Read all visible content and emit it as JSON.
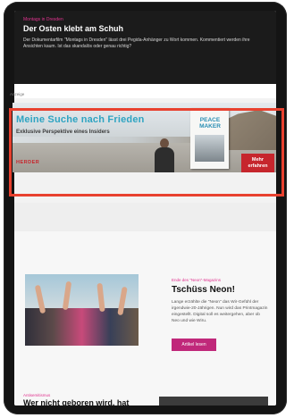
{
  "top_article": {
    "kicker": "Montags in Dresden",
    "title": "Der Osten klebt am Schuh",
    "teaser": "Der Dokumentarfilm \"Montags in Dresden\" lässt drei Pegida-Anhänger zu Wort kommen. Kommentiert werden ihre Ansichten kaum. Ist das skandalös oder genau richtig?"
  },
  "ad": {
    "label": "Anzeige",
    "headline": "Meine Suche nach Frieden",
    "subline": "Exklusive Perspektive eines Insiders",
    "brand": "HERDER",
    "book_title": "PEACE\nMAKER",
    "cta": "Mehr\nerfahren",
    "highlight_color": "#e8412f"
  },
  "card": {
    "kicker": "Ende des \"Neon\"-Magazins",
    "title": "Tschüss Neon!",
    "text": "Lange erzählte die \"Neon\" das Wir-Gefühl der irgendwie-20-Jährigen. Nun wird das Printmagazin eingestellt. Digital soll es weitergehen, aber ob Neo und wie Wiru.",
    "button": "Artikel lesen",
    "accent": "#c0287a"
  },
  "next": {
    "kicker": "Antisemitismus",
    "title": "Wer nicht geboren wird, hat"
  }
}
